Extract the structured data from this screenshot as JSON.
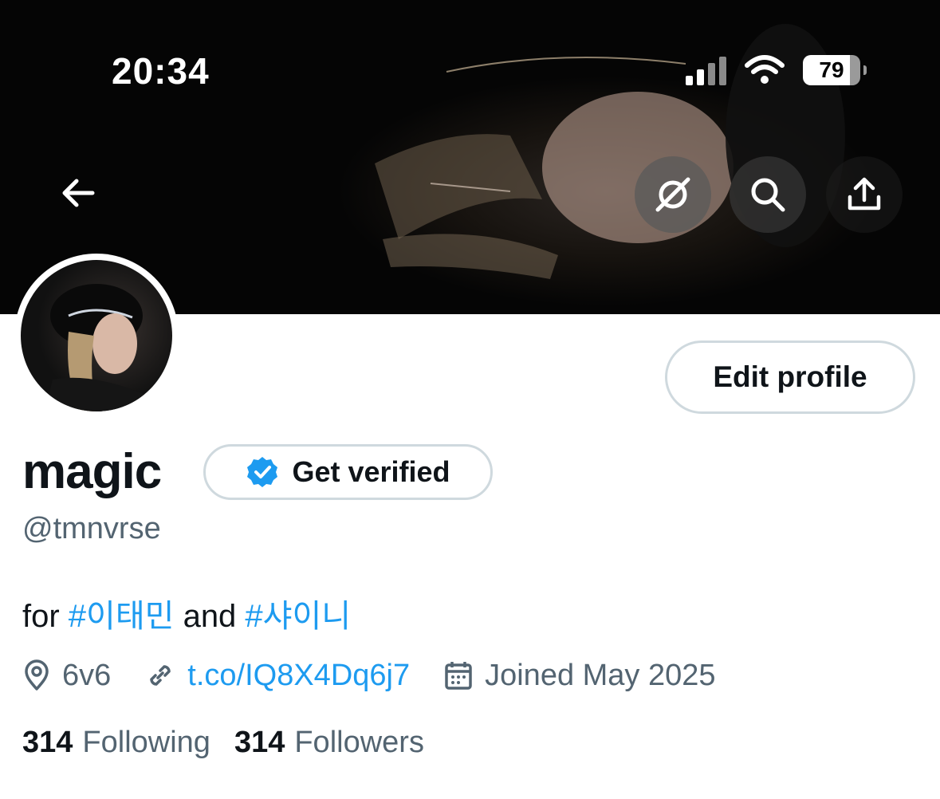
{
  "status_bar": {
    "time": "20:34",
    "battery": "79"
  },
  "header": {
    "back_icon": "arrow-left-icon",
    "grok_icon": "grok-icon",
    "search_icon": "search-icon",
    "share_icon": "share-icon"
  },
  "profile": {
    "display_name": "magic",
    "handle": "@tmnvrse",
    "edit_label": "Edit profile",
    "verify_label": "Get verified",
    "bio": {
      "text1": "for ",
      "tag1": "#이태민",
      "text2": " and ",
      "tag2": "#샤이니"
    },
    "location": "6v6",
    "website": "t.co/IQ8X4Dq6j7",
    "joined": "Joined May 2025",
    "following_count": "314",
    "following_label": "Following",
    "followers_count": "314",
    "followers_label": "Followers"
  },
  "colors": {
    "accent": "#1d9bf0",
    "secondary_text": "#536471",
    "border": "#cfd9de"
  }
}
